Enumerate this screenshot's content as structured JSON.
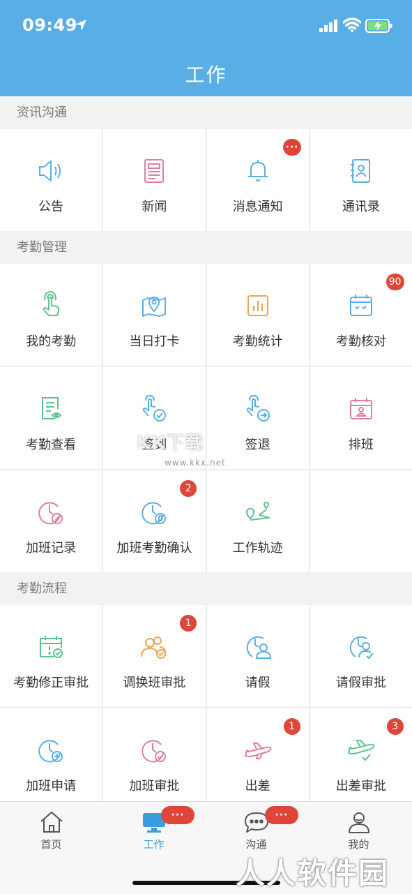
{
  "status": {
    "time": "09:49"
  },
  "header": {
    "title": "工作"
  },
  "sections": [
    {
      "title": "资讯沟通",
      "items": [
        {
          "label": "公告",
          "icon": "speaker-icon",
          "color": "#5aaee6"
        },
        {
          "label": "新闻",
          "icon": "newspaper-icon",
          "color": "#e07f9a"
        },
        {
          "label": "消息通知",
          "icon": "bell-icon",
          "color": "#5aaee6",
          "badge": "···"
        },
        {
          "label": "通讯录",
          "icon": "contacts-icon",
          "color": "#5aaee6"
        }
      ]
    },
    {
      "title": "考勤管理",
      "items": [
        {
          "label": "我的考勤",
          "icon": "touch-hand-icon",
          "color": "#5cc48a"
        },
        {
          "label": "当日打卡",
          "icon": "map-location-icon",
          "color": "#5aaee6"
        },
        {
          "label": "考勤统计",
          "icon": "bar-stats-icon",
          "color": "#f0a34a"
        },
        {
          "label": "考勤核对",
          "icon": "calendar-icon",
          "color": "#5aaee6",
          "badge": "90"
        },
        {
          "label": "考勤查看",
          "icon": "document-eye-icon",
          "color": "#5cc48a"
        },
        {
          "label": "签到",
          "icon": "hand-check-icon",
          "color": "#5aaee6"
        },
        {
          "label": "签退",
          "icon": "hand-arrow-icon",
          "color": "#5aaee6"
        },
        {
          "label": "排班",
          "icon": "calendar-person-icon",
          "color": "#e07f9a"
        },
        {
          "label": "加班记录",
          "icon": "clock-pen-icon",
          "color": "#e07f9a"
        },
        {
          "label": "加班考勤确认",
          "icon": "clock-hand-icon",
          "color": "#5aaee6",
          "badge": "2"
        },
        {
          "label": "工作轨迹",
          "icon": "route-icon",
          "color": "#5cc48a"
        },
        {
          "label": "",
          "icon": "",
          "color": ""
        }
      ]
    },
    {
      "title": "考勤流程",
      "items": [
        {
          "label": "考勤修正审批",
          "icon": "calendar-check-icon",
          "color": "#5cc48a"
        },
        {
          "label": "调换班审批",
          "icon": "people-check-icon",
          "color": "#f0a34a",
          "badge": "1"
        },
        {
          "label": "请假",
          "icon": "clock-person-icon",
          "color": "#5aaee6"
        },
        {
          "label": "请假审批",
          "icon": "clock-person-check-icon",
          "color": "#5aaee6"
        },
        {
          "label": "加班申请",
          "icon": "clock-plus-icon",
          "color": "#5aaee6"
        },
        {
          "label": "加班审批",
          "icon": "clock-check-icon",
          "color": "#e07f9a"
        },
        {
          "label": "出差",
          "icon": "airplane-icon",
          "color": "#e07f9a",
          "badge": "1"
        },
        {
          "label": "出差审批",
          "icon": "airplane-check-icon",
          "color": "#5cc48a",
          "badge": "3"
        }
      ]
    }
  ],
  "tabs": [
    {
      "label": "首页",
      "icon": "home-icon",
      "badge": ""
    },
    {
      "label": "工作",
      "icon": "monitor-icon",
      "badge": "···",
      "active": true
    },
    {
      "label": "沟通",
      "icon": "chat-icon",
      "badge": "···"
    },
    {
      "label": "我的",
      "icon": "person-icon",
      "badge": ""
    }
  ],
  "watermarks": {
    "top": "KK下载",
    "url": "www.kkx.net",
    "bottom": "人人软件园"
  },
  "colors": {
    "header": "#5aaee6",
    "badge": "#e0453a",
    "active_tab": "#3a9be0"
  }
}
